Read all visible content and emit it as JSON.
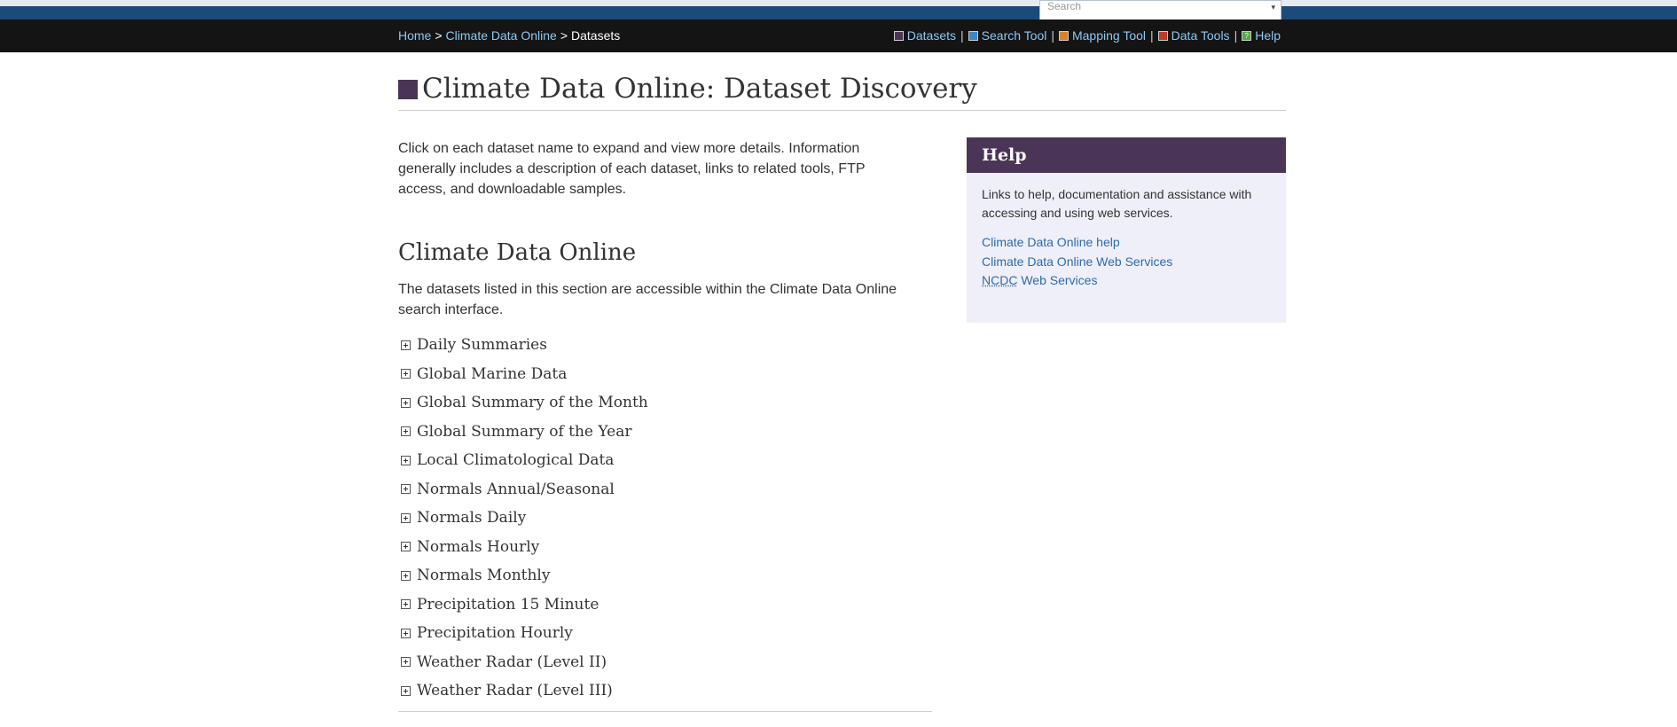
{
  "topbar": {
    "search_placeholder": "Search"
  },
  "breadcrumb": {
    "home": "Home",
    "cdo": "Climate Data Online",
    "current": "Datasets",
    "separator": ">"
  },
  "toolnav": {
    "items": [
      {
        "label": "Datasets",
        "color": "#4b3557",
        "icon": "datasets-square-icon"
      },
      {
        "label": "Search Tool",
        "color": "#3f86c6",
        "icon": "search-tool-square-icon"
      },
      {
        "label": "Mapping Tool",
        "color": "#d9822b",
        "icon": "mapping-tool-square-icon"
      },
      {
        "label": "Data Tools",
        "color": "#c0392b",
        "icon": "data-tools-square-icon"
      },
      {
        "label": "Help",
        "color": "#5aa34a",
        "icon": "help-square-icon",
        "glyph": "?"
      }
    ]
  },
  "page": {
    "title": "Climate Data Online: Dataset Discovery",
    "title_accent": "#4b3557",
    "intro": "Click on each dataset name to expand and view more details. Information generally includes a description of each dataset, links to related tools, FTP access, and downloadable samples."
  },
  "section": {
    "heading": "Climate Data Online",
    "description": "The datasets listed in this section are accessible within the Climate Data Online search interface.",
    "datasets": [
      "Daily Summaries",
      "Global Marine Data",
      "Global Summary of the Month",
      "Global Summary of the Year",
      "Local Climatological Data",
      "Normals Annual/Seasonal",
      "Normals Daily",
      "Normals Hourly",
      "Normals Monthly",
      "Precipitation 15 Minute",
      "Precipitation Hourly",
      "Weather Radar (Level II)",
      "Weather Radar (Level III)"
    ]
  },
  "help": {
    "title": "Help",
    "text": "Links to help, documentation and assistance with accessing and using web services.",
    "links": {
      "cdo_help": "Climate Data Online help",
      "cdo_web_services": "Climate Data Online Web Services",
      "ncdc_abbr": "NCDC",
      "ncdc_suffix": " Web Services"
    }
  }
}
